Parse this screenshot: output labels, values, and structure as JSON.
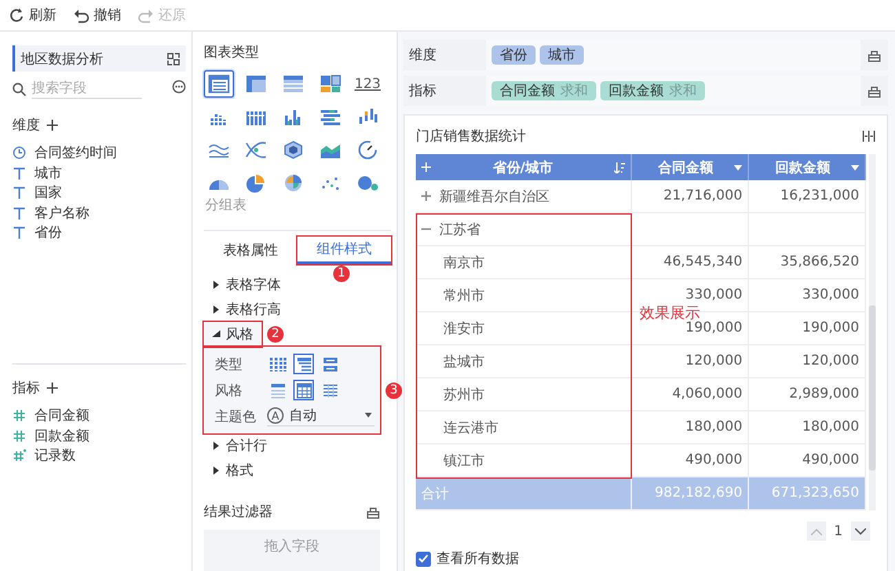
{
  "toolbar": [
    {
      "kind": "refresh",
      "label": "刷新",
      "disabled": false
    },
    {
      "kind": "undo",
      "label": "撤销",
      "disabled": false
    },
    {
      "kind": "redo",
      "label": "还原",
      "disabled": true
    }
  ],
  "data_panel": {
    "dataset": "地区数据分析",
    "search": {
      "placeholder": "搜索字段"
    },
    "dimensions": {
      "title": "维度",
      "items": [
        {
          "kind": "date",
          "label": "合同签约时间"
        },
        {
          "kind": "text",
          "label": "城市"
        },
        {
          "kind": "text",
          "label": "国家"
        },
        {
          "kind": "text",
          "label": "客户名称"
        },
        {
          "kind": "text",
          "label": "省份"
        }
      ]
    },
    "measures": {
      "title": "指标",
      "items": [
        {
          "kind": "number",
          "label": "合同金额"
        },
        {
          "kind": "number",
          "label": "回款金额"
        },
        {
          "kind": "count",
          "label": "记录数"
        }
      ]
    }
  },
  "config_panel": {
    "chart_type_title": "图表类型",
    "chart_types": [
      {
        "kind": "table",
        "selected": true
      },
      {
        "kind": "pivot",
        "selected": false
      },
      {
        "kind": "list",
        "selected": false
      },
      {
        "kind": "blocks",
        "selected": false
      },
      {
        "kind": "kpi",
        "label": "123",
        "selected": false
      },
      {
        "kind": "dotbars",
        "selected": false
      },
      {
        "kind": "grouped",
        "selected": false
      },
      {
        "kind": "column",
        "selected": false
      },
      {
        "kind": "hbar",
        "selected": false
      },
      {
        "kind": "range",
        "selected": false
      },
      {
        "kind": "line",
        "selected": false
      },
      {
        "kind": "cross",
        "selected": false
      },
      {
        "kind": "hexagon",
        "selected": false
      },
      {
        "kind": "area",
        "selected": false
      },
      {
        "kind": "gauge",
        "selected": false
      },
      {
        "kind": "halfpie",
        "caption": "分组表",
        "selected": false
      },
      {
        "kind": "pie",
        "selected": false
      },
      {
        "kind": "rose",
        "selected": false
      },
      {
        "kind": "scatter",
        "selected": false
      },
      {
        "kind": "bubble",
        "selected": false
      }
    ],
    "tabs": [
      {
        "label": "表格属性",
        "selected": false
      },
      {
        "label": "组件样式",
        "selected": true,
        "annotation": "1"
      }
    ],
    "sections_before": [
      {
        "label": "表格字体",
        "expanded": false
      },
      {
        "label": "表格行高",
        "expanded": false
      },
      {
        "label": "风格",
        "expanded": true,
        "annotation": "2"
      }
    ],
    "style_options": {
      "annotation": "3",
      "rows": [
        {
          "kind": "icons",
          "label": "类型",
          "options": [
            {
              "kind": "columns",
              "selected": false
            },
            {
              "kind": "tree",
              "selected": true
            },
            {
              "kind": "groups",
              "selected": false
            }
          ]
        },
        {
          "kind": "icons",
          "label": "风格",
          "options": [
            {
              "kind": "header",
              "selected": false
            },
            {
              "kind": "grid",
              "selected": true
            },
            {
              "kind": "lines",
              "selected": false
            }
          ]
        },
        {
          "kind": "select",
          "label": "主题色",
          "badge": "A",
          "value": "自动"
        }
      ]
    },
    "sections_after": [
      {
        "label": "合计行",
        "expanded": false
      },
      {
        "label": "格式",
        "expanded": false
      }
    ],
    "filter": {
      "title": "结果过滤器",
      "placeholder": "拖入字段"
    }
  },
  "report": {
    "dimension_row": {
      "label": "维度",
      "chips": [
        {
          "name": "省份"
        },
        {
          "name": "城市"
        }
      ]
    },
    "measure_row": {
      "label": "指标",
      "chips": [
        {
          "name": "合同金额",
          "aggregation": "求和"
        },
        {
          "name": "回款金额",
          "aggregation": "求和"
        }
      ]
    },
    "table": {
      "title": "门店销售数据统计",
      "columns": [
        "省份/城市",
        "合同金额",
        "回款金额"
      ],
      "rows": [
        {
          "label": "新疆维吾尔自治区",
          "expanded": false,
          "values": [
            "21,716,000",
            "16,231,000"
          ]
        },
        {
          "label": "江苏省",
          "expanded": true,
          "children": [
            {
              "label": "南京市",
              "values": [
                "46,545,340",
                "35,866,520"
              ]
            },
            {
              "label": "常州市",
              "values": [
                "330,000",
                "330,000"
              ]
            },
            {
              "label": "淮安市",
              "values": [
                "190,000",
                "190,000"
              ]
            },
            {
              "label": "盐城市",
              "values": [
                "120,000",
                "120,000"
              ]
            },
            {
              "label": "苏州市",
              "values": [
                "4,060,000",
                "2,989,000"
              ]
            },
            {
              "label": "连云港市",
              "values": [
                "180,000",
                "180,000"
              ]
            },
            {
              "label": "镇江市",
              "values": [
                "490,000",
                "490,000"
              ]
            }
          ]
        }
      ],
      "total": {
        "label": "合计",
        "values": [
          "982,182,690",
          "671,323,650"
        ]
      },
      "annotation_caption": "效果展示",
      "page": "1",
      "show_all": {
        "label": "查看所有数据",
        "checked": true
      }
    }
  }
}
